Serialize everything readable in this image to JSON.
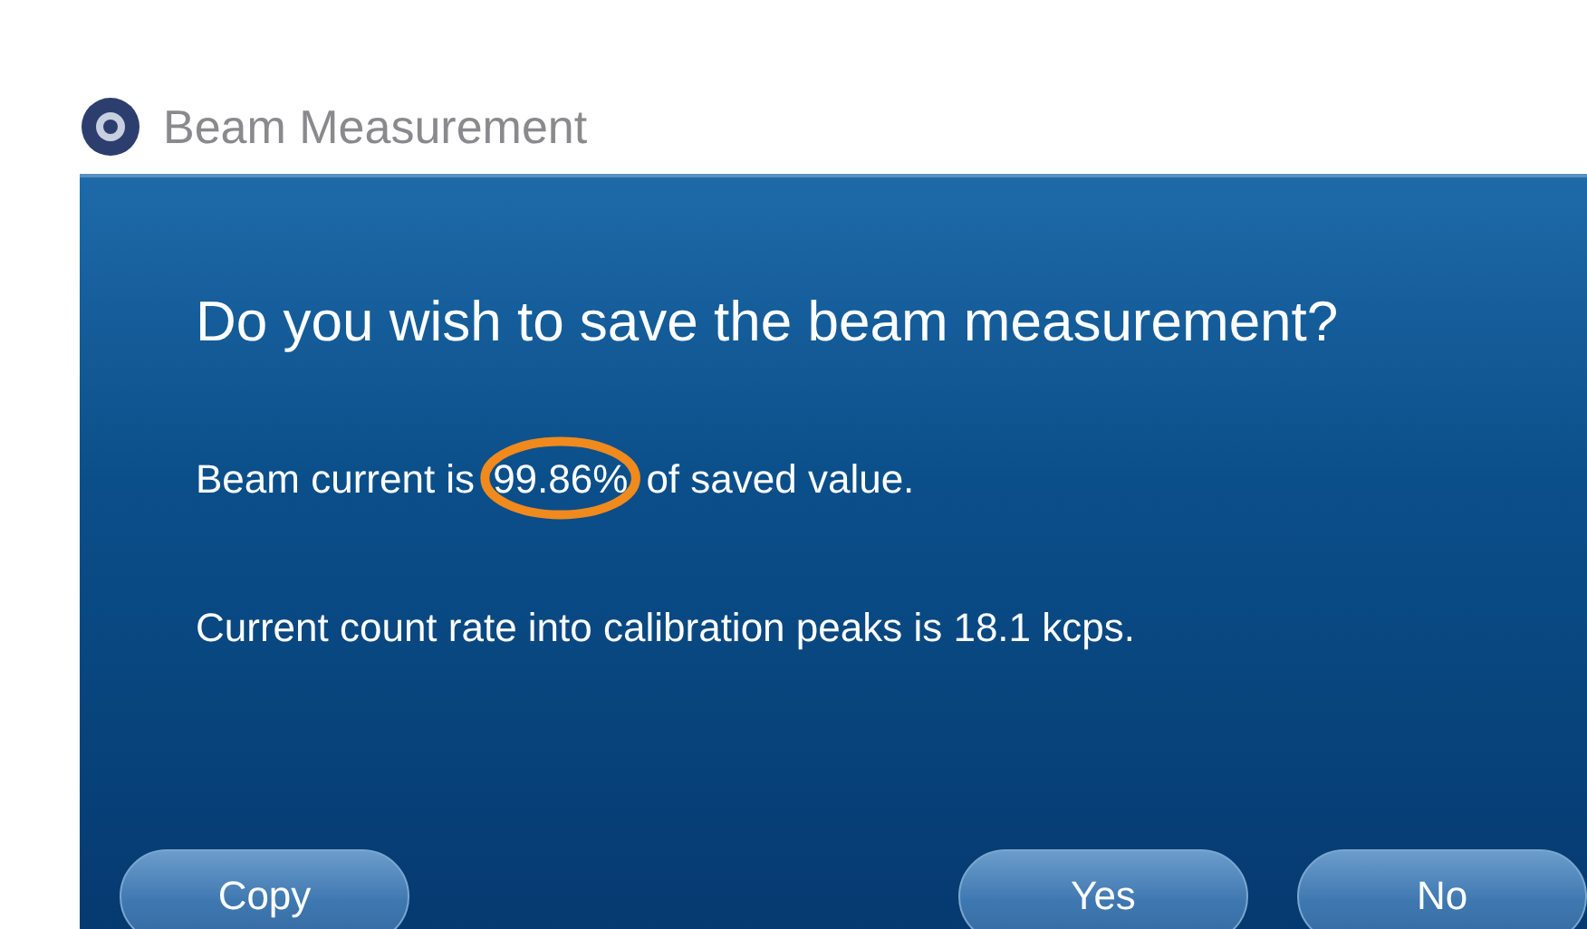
{
  "window": {
    "title": "Beam Measurement"
  },
  "question": "Do you wish to save the beam measurement?",
  "messages": [
    {
      "kind": "highlighted",
      "before": "Beam current is",
      "value": "99.86%",
      "after": "of saved value."
    },
    {
      "kind": "plain",
      "text": "Current count rate into calibration peaks is 18.1 kcps."
    }
  ],
  "left_buttons": [
    "Copy"
  ],
  "right_buttons": [
    "Yes",
    "No"
  ]
}
